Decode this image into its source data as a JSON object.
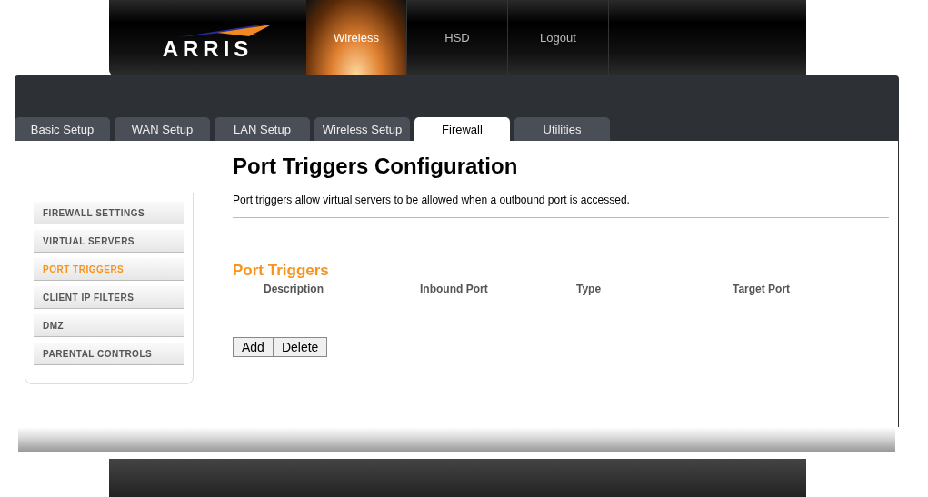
{
  "logo": {
    "text": "ARRIS"
  },
  "top_nav": [
    {
      "label": "Wireless",
      "selected": true
    },
    {
      "label": "HSD",
      "selected": false
    },
    {
      "label": "Logout",
      "selected": false
    }
  ],
  "tabs": [
    {
      "label": "Basic Setup",
      "selected": false
    },
    {
      "label": "WAN Setup",
      "selected": false
    },
    {
      "label": "LAN Setup",
      "selected": false
    },
    {
      "label": "Wireless Setup",
      "selected": false
    },
    {
      "label": "Firewall",
      "selected": true
    },
    {
      "label": "Utilities",
      "selected": false
    }
  ],
  "sidebar": {
    "items": [
      {
        "label": "FIREWALL SETTINGS",
        "selected": false
      },
      {
        "label": "VIRTUAL SERVERS",
        "selected": false
      },
      {
        "label": "PORT TRIGGERS",
        "selected": true
      },
      {
        "label": "CLIENT IP FILTERS",
        "selected": false
      },
      {
        "label": "DMZ",
        "selected": false
      },
      {
        "label": "PARENTAL CONTROLS",
        "selected": false
      }
    ]
  },
  "page": {
    "title": "Port Triggers Configuration",
    "description": "Port triggers allow virtual servers to be allowed when a outbound port is accessed.",
    "section_title": "Port Triggers"
  },
  "table": {
    "columns": [
      "Description",
      "Inbound Port",
      "Type",
      "Target Port"
    ]
  },
  "buttons": [
    "Add",
    "Delete"
  ]
}
